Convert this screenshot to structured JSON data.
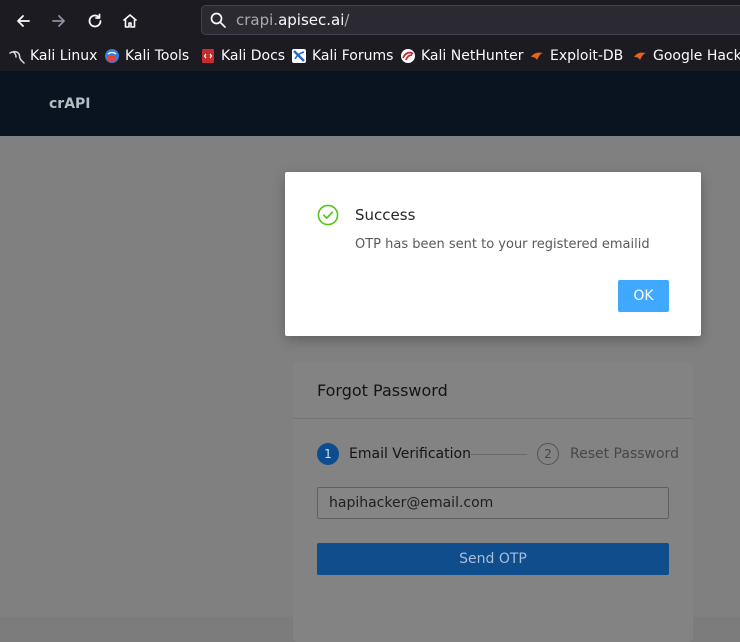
{
  "browser": {
    "url_host_prefix": "crapi.",
    "url_host_main": "apisec.ai",
    "url_path": "/",
    "bookmarks": [
      {
        "label": "Kali Linux",
        "icon": "kali-dragon-icon"
      },
      {
        "label": "Kali Tools",
        "icon": "kali-tools-icon"
      },
      {
        "label": "Kali Docs",
        "icon": "kali-docs-icon"
      },
      {
        "label": "Kali Forums",
        "icon": "kali-forums-icon"
      },
      {
        "label": "Kali NetHunter",
        "icon": "kali-nethunter-icon"
      },
      {
        "label": "Exploit-DB",
        "icon": "exploit-db-icon"
      },
      {
        "label": "Google Hacki",
        "icon": "ghdb-icon"
      }
    ]
  },
  "site": {
    "brand": "crAPI"
  },
  "forgot": {
    "title": "Forgot Password",
    "steps": [
      {
        "num": "1",
        "label": "Email Verification"
      },
      {
        "num": "2",
        "label": "Reset Password"
      }
    ],
    "email_value": "hapihacker@email.com",
    "send_label": "Send OTP"
  },
  "modal": {
    "title": "Success",
    "message": "OTP has been sent to your registered emailid",
    "ok_label": "OK"
  },
  "colors": {
    "success": "#52c41a",
    "primary": "#40a9ff"
  }
}
